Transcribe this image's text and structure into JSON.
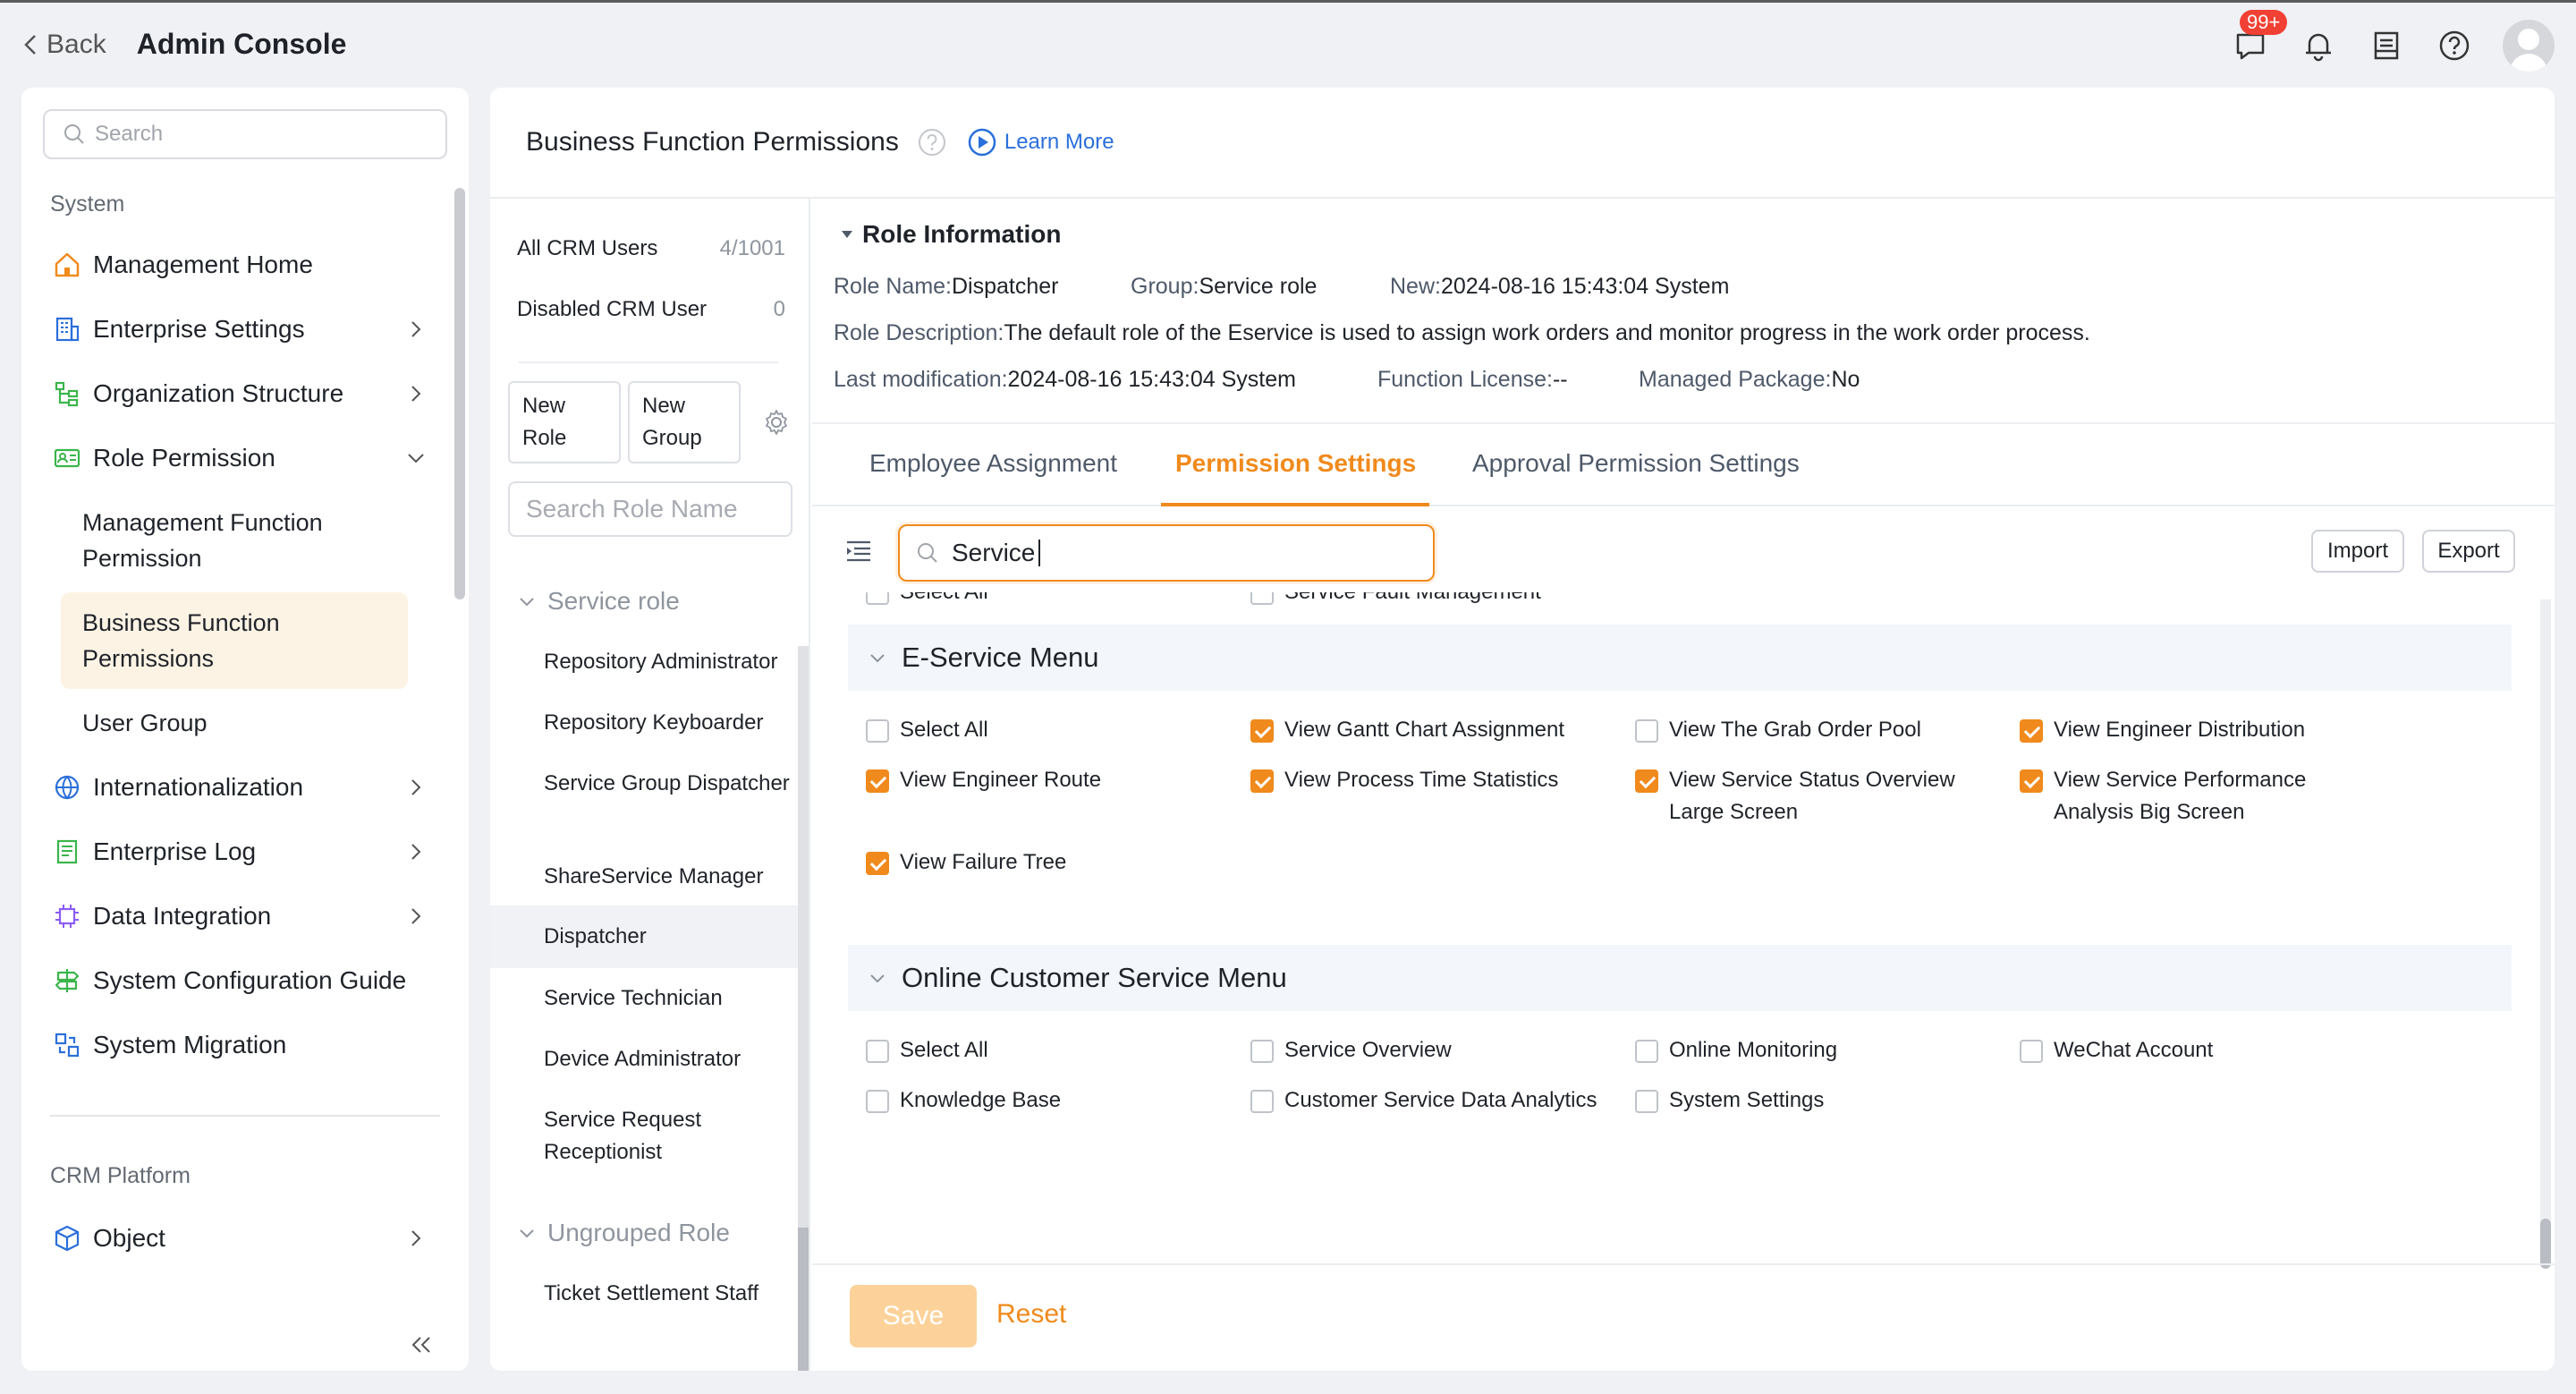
{
  "topbar": {
    "back_label": "Back",
    "title": "Admin Console",
    "notification_badge": "99+",
    "icons": [
      "chat-icon",
      "bell-icon",
      "inbox-icon",
      "help-icon",
      "avatar"
    ]
  },
  "sidebar": {
    "search_placeholder": "Search",
    "section_system": "System",
    "items": [
      {
        "label": "Management Home",
        "icon": "home-icon"
      },
      {
        "label": "Enterprise Settings",
        "icon": "building-icon"
      },
      {
        "label": "Organization Structure",
        "icon": "org-tree-icon"
      },
      {
        "label": "Role Permission",
        "icon": "id-card-icon"
      },
      {
        "label": "Internationalization",
        "icon": "globe-icon"
      },
      {
        "label": "Enterprise Log",
        "icon": "log-icon"
      },
      {
        "label": "Data Integration",
        "icon": "chip-icon"
      },
      {
        "label": "System Configuration Guide",
        "icon": "signpost-icon"
      },
      {
        "label": "System Migration",
        "icon": "migration-icon"
      }
    ],
    "sub_items": [
      {
        "label": "Management Function Permission"
      },
      {
        "label": "Business Function Permissions"
      },
      {
        "label": "User Group"
      }
    ],
    "section_platform": "CRM Platform",
    "platform_items": [
      {
        "label": "Object",
        "icon": "cube-icon"
      }
    ]
  },
  "header": {
    "title": "Business Function Permissions",
    "learn_more": "Learn More"
  },
  "roles": {
    "all_users_label": "All CRM Users",
    "all_users_count": "4/1001",
    "disabled_label": "Disabled CRM User",
    "disabled_count": "0",
    "new_role": "New Role",
    "new_group": "New Group",
    "search_placeholder": "Search Role Name",
    "group_service": "Service role",
    "service_roles": [
      "Repository Administrator",
      "Repository Keyboarder",
      "Service Group Dispatcher",
      "ShareService Manager",
      "Dispatcher",
      "Service Technician",
      "Device Administrator",
      "Service Request Receptionist"
    ],
    "group_ungrouped": "Ungrouped Role",
    "ungrouped_roles": [
      "Ticket Settlement Staff"
    ]
  },
  "role_info": {
    "title": "Role Information",
    "role_name_key": "Role Name:",
    "role_name": "Dispatcher",
    "group_key": "Group:",
    "group": "Service role",
    "new_key": "New:",
    "new": "2024-08-16 15:43:04 System",
    "desc_key": "Role Description:",
    "desc": "The default role of the Eservice is used to assign work orders and monitor progress in the work order process.",
    "lastmod_key": "Last modification:",
    "lastmod": "2024-08-16 15:43:04 System",
    "license_key": "Function License:",
    "license": "--",
    "package_key": "Managed Package:",
    "package": "No"
  },
  "tabs": [
    "Employee Assignment",
    "Permission Settings",
    "Approval Permission Settings"
  ],
  "active_tab": "Permission Settings",
  "perm_search": {
    "value": "Service"
  },
  "buttons": {
    "import": "Import",
    "export": "Export",
    "save": "Save",
    "reset": "Reset"
  },
  "partial_row": [
    {
      "label": "Select All",
      "checked": false
    },
    {
      "label": "Service Fault Management",
      "checked": false
    }
  ],
  "sections": [
    {
      "title": "E-Service Menu",
      "items": [
        {
          "label": "Select All",
          "checked": false
        },
        {
          "label": "View Gantt Chart Assignment",
          "checked": true
        },
        {
          "label": "View The Grab Order Pool",
          "checked": false
        },
        {
          "label": "View Engineer Distribution",
          "checked": true
        },
        {
          "label": "View Engineer Route",
          "checked": true
        },
        {
          "label": "View Process Time Statistics",
          "checked": true
        },
        {
          "label": "View Service Status Overview Large Screen",
          "checked": true
        },
        {
          "label": "View Service Performance Analysis Big Screen",
          "checked": true
        },
        {
          "label": "View Failure Tree",
          "checked": true
        }
      ]
    },
    {
      "title": "Online Customer Service Menu",
      "items": [
        {
          "label": "Select All",
          "checked": false
        },
        {
          "label": "Service Overview",
          "checked": false
        },
        {
          "label": "Online Monitoring",
          "checked": false
        },
        {
          "label": "WeChat Account",
          "checked": false
        },
        {
          "label": "Knowledge Base",
          "checked": false
        },
        {
          "label": "Customer Service Data Analytics",
          "checked": false
        },
        {
          "label": "System Settings",
          "checked": false
        }
      ]
    }
  ],
  "colors": {
    "accent": "#f08a1c",
    "link": "#2a6fdb",
    "badge": "#f04134"
  }
}
